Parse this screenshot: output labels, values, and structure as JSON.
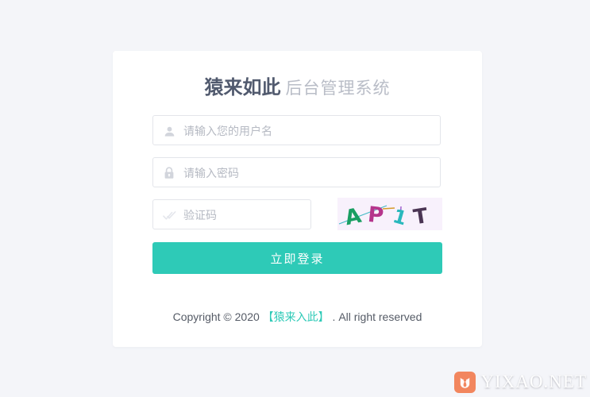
{
  "page": {
    "background_color": "#f4f5f9"
  },
  "card": {
    "background_color": "#ffffff",
    "title": {
      "brand": "猿来如此",
      "subtitle": "后台管理系统"
    },
    "form": {
      "username": {
        "icon": "user-icon",
        "placeholder": "请输入您的用户名",
        "value": ""
      },
      "password": {
        "icon": "lock-icon",
        "placeholder": "请输入密码",
        "value": ""
      },
      "captcha": {
        "icon": "check-icon",
        "placeholder": "验证码",
        "value": "",
        "image": {
          "background_color": "#f8f1fc",
          "characters": [
            {
              "text": "A",
              "color": "#1a9e62"
            },
            {
              "text": "P",
              "color": "#b5358c"
            },
            {
              "text": "1",
              "color": "#2ab8bd"
            },
            {
              "text": "T",
              "color": "#4b3554"
            }
          ],
          "noise_line_colors": [
            "#3fb9c4",
            "#d59b2a",
            "#8b3fc4"
          ]
        }
      },
      "submit": {
        "label": "立即登录",
        "color": "#2ecab7"
      }
    },
    "copyright": {
      "prefix": "Copyright © 2020 ",
      "link": "【猿来入此】",
      "suffix": " . All right reserved",
      "link_color": "#2ecab7"
    }
  },
  "watermark": {
    "logo_icon": "yixao-logo-icon",
    "logo_color": "#f2865e",
    "text": "YIXAO.NET"
  }
}
